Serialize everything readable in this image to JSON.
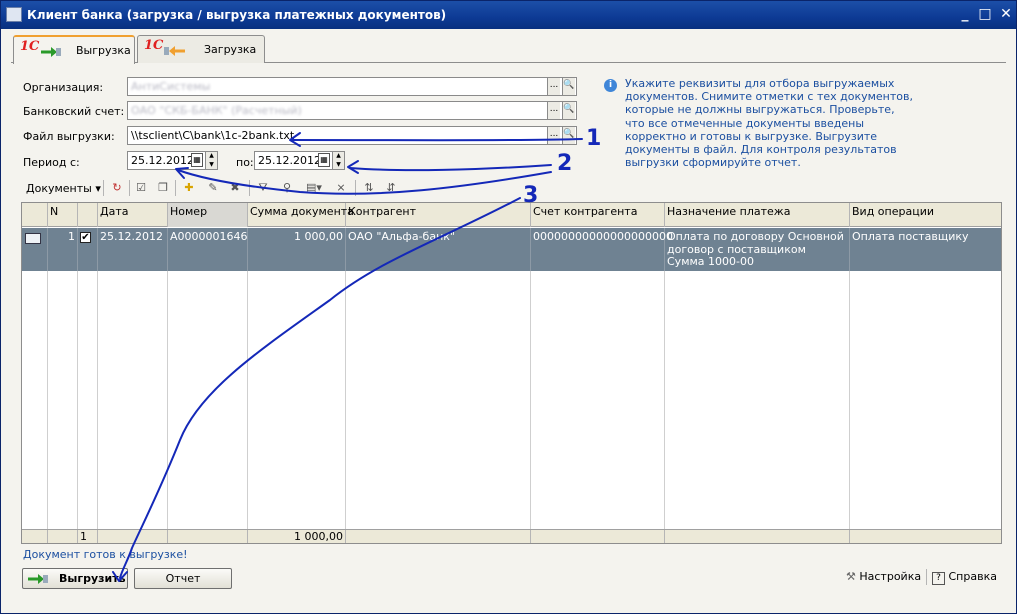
{
  "window": {
    "title": "Клиент банка (загрузка / выгрузка платежных документов)",
    "minimize": "_",
    "maximize": "□",
    "close": "✕"
  },
  "tabs": [
    {
      "logo": "1С",
      "label": "Выгрузка",
      "active": true
    },
    {
      "logo": "1С",
      "label": "Загрузка",
      "active": false
    }
  ],
  "form": {
    "org_label": "Организация:",
    "org_value": "АнтиСистемы",
    "bank_label": "Банковский счет:",
    "bank_value": "ОАО \"СКБ-БАНК\" (Расчетный)",
    "file_label": "Файл выгрузки:",
    "file_value": "\\\\tsclient\\C\\bank\\1c-2bank.txt",
    "period_label": "Период с:",
    "period_from": "25.12.2012",
    "to_label": "по:",
    "period_to": "25.12.2012",
    "dots": "...",
    "search_icon": "search-icon"
  },
  "hint": {
    "icon": "info-icon",
    "text": "Укажите реквизиты для отбора выгружаемых документов. Снимите отметки с тех документов, которые не должны выгружаться. Проверьте, что все отмеченные документы введены корректно и готовы к выгрузке. Выгрузите документы в файл. Для контроля результатов выгрузки сформируйте отчет."
  },
  "toolbar": {
    "documents_label": "Документы ▾",
    "icons": [
      "refresh-icon",
      "check-all-icon",
      "uncheck-all-icon",
      "add-icon",
      "edit-icon",
      "delete-icon",
      "filter-icon",
      "filter-settings-icon",
      "filter-dropdown-icon",
      "clear-filter-icon",
      "sort-asc-icon",
      "sort-desc-icon"
    ]
  },
  "table": {
    "columns": [
      "N",
      "Дата",
      "Номер",
      "Сумма документа",
      "Контрагент",
      "Счет контрагента",
      "Назначение платежа",
      "Вид операции"
    ],
    "rows": [
      {
        "n": "1",
        "checked": true,
        "date": "25.12.2012",
        "number": "А0000001646",
        "amount": "1 000,00",
        "counterparty": "ОАО \"Альфа-банк\"",
        "account": "00000000000000000000",
        "purpose_lines": [
          "Оплата по договору Основной",
          "договор с поставщиком",
          "Сумма 1000-00"
        ],
        "operation": "Оплата поставщику"
      }
    ],
    "footer": {
      "count": "1",
      "total": "1 000,00"
    }
  },
  "status_text": "Документ готов к выгрузке!",
  "buttons": {
    "export": "Выгрузить",
    "report": "Отчет",
    "settings": "Настройка",
    "help": "Справка"
  },
  "annotations": [
    "1",
    "2",
    "3"
  ],
  "colors": {
    "title_bar": "#0d3a94",
    "selected_row": "#6f8292",
    "hint_text": "#1b4fa0",
    "annotation_ink": "#1428b8"
  }
}
